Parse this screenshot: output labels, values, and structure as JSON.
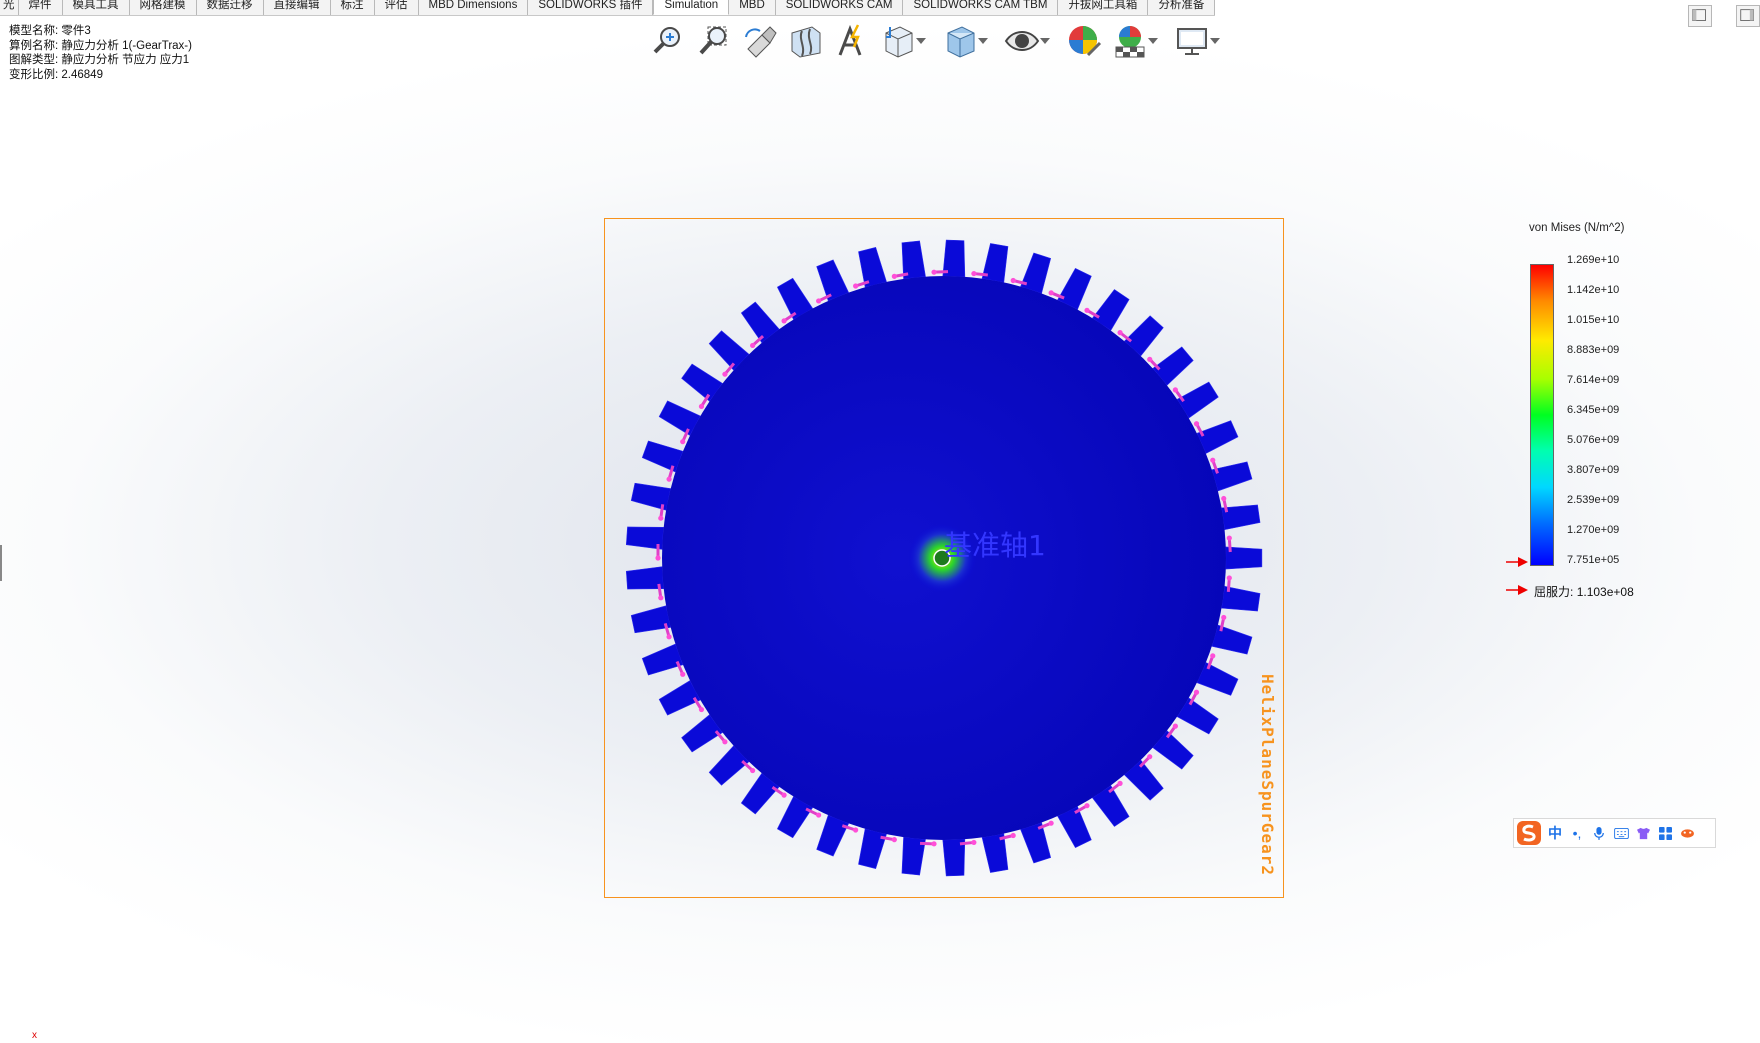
{
  "tabs": [
    {
      "label": "焊件"
    },
    {
      "label": "模具工具"
    },
    {
      "label": "网格建模"
    },
    {
      "label": "数据迁移"
    },
    {
      "label": "直接编辑"
    },
    {
      "label": "标注"
    },
    {
      "label": "评估"
    },
    {
      "label": "MBD Dimensions"
    },
    {
      "label": "SOLIDWORKS 插件"
    },
    {
      "label": "Simulation",
      "active": true
    },
    {
      "label": "MBD"
    },
    {
      "label": "SOLIDWORKS CAM"
    },
    {
      "label": "SOLIDWORKS CAM TBM"
    },
    {
      "label": "开拔网工具箱"
    },
    {
      "label": "分析准备"
    }
  ],
  "first_tab_fragment": "光",
  "info": {
    "model_label": "模型名称:",
    "model_value": "零件3",
    "study_label": "算例名称:",
    "study_value": "静应力分析 1(-GearTrax-)",
    "plot_label": "图解类型:",
    "plot_value": "静应力分析 节应力 应力1",
    "scale_label": "变形比例:",
    "scale_value": "2.46849"
  },
  "toolbar_icons": [
    "zoom-to-fit-icon",
    "zoom-to-area-icon",
    "previous-view-icon",
    "section-view-icon",
    "dynamic-annotation-icon",
    "view-orientation-icon",
    "display-style-icon",
    "hide-show-items-icon",
    "edit-appearance-icon",
    "apply-scene-icon",
    "view-settings-icon"
  ],
  "viewport": {
    "axis_label": "基准轴1",
    "bbox_label": "HelixPlaneSpurGear2",
    "bbox_color": "#f7931e",
    "gear_color": "#0a0ad8",
    "gear_teeth": 45
  },
  "legend": {
    "title": "von Mises (N/m^2)",
    "ticks": [
      "1.269e+10",
      "1.142e+10",
      "1.015e+10",
      "8.883e+09",
      "7.614e+09",
      "6.345e+09",
      "5.076e+09",
      "3.807e+09",
      "2.539e+09",
      "1.270e+09",
      "7.751e+05"
    ],
    "yield_label": "屈服力:",
    "yield_value": "1.103e+08"
  },
  "ime": {
    "mode": "中",
    "icons": [
      "punctuation-icon",
      "microphone-icon",
      "keyboard-icon",
      "skin-icon",
      "toolbox-icon",
      "settings-icon"
    ]
  },
  "corner_mark": "x"
}
